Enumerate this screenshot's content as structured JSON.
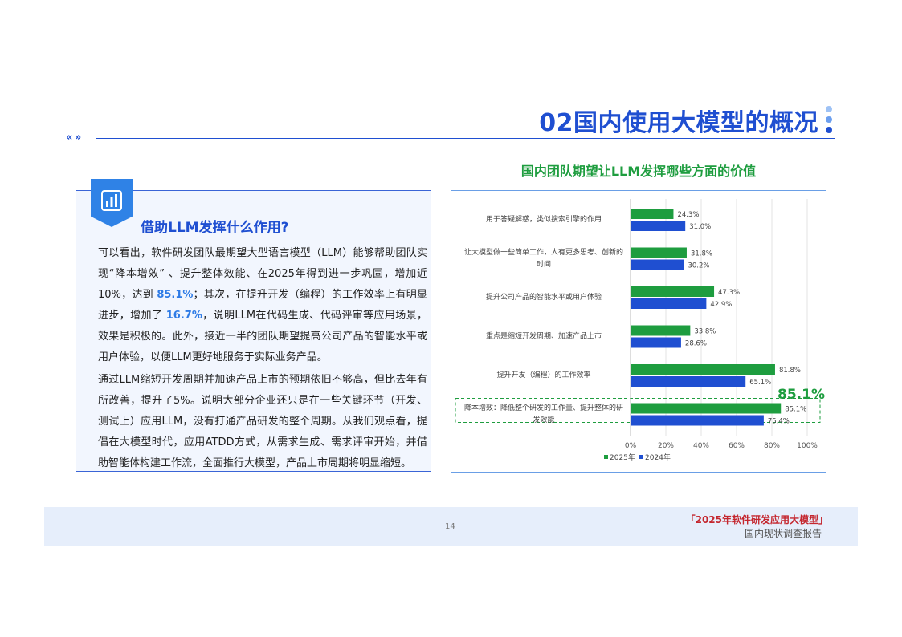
{
  "header": {
    "title": "02国内使用大模型的概况",
    "nav_chevrons": "« »"
  },
  "text_card": {
    "heading": "借助LLM发挥什么作用?",
    "para1": [
      "可以看出，软件研发团队最期望大型语言模型（LLM）能够帮助团队实现“降本增效” 、提升整体效能、在2025年得到进一步巩固，增加近10%，达到 ",
      "85.1%",
      "；其次，在提升开发（编程）的工作效率上有明显进步，增加了 ",
      "16.7%",
      "，说明LLM在代码生成、代码评审等应用场景，效果是积极的。此外，接近一半的团队期望提高公司产品的智能水平或用户体验，以便LLM更好地服务于实际业务产品。"
    ],
    "para2": "通过LLM缩短开发周期并加速产品上市的预期依旧不够高，但比去年有所改善，提升了5%。说明大部分企业还只是在一些关键环节（开发、测试上）应用LLM，没有打通产品研发的整个周期。从我们观点看，提倡在大模型时代，应用ATDD方式，从需求生成、需求评审开始，并借助智能体构建工作流，全面推行大模型，产品上市周期将明显缩短。"
  },
  "chart_title": "国内团队期望让LLM发挥哪些方面的价值",
  "callout": "85.1%",
  "chart_data": {
    "type": "bar",
    "orientation": "horizontal",
    "title": "国内团队期望让LLM发挥哪些方面的价值",
    "categories": [
      [
        "用于答疑解惑，类似搜索引擎的作用"
      ],
      [
        "让大模型做一些简单工作，人有更多思考、创新的",
        "时间"
      ],
      [
        "提升公司产品的智能水平或用户体验"
      ],
      [
        "重点是缩短开发周期、加速产品上市"
      ],
      [
        "提升开发（编程）的工作效率"
      ],
      [
        "降本增效：降低整个研发的工作量、提升整体的研",
        "发效能"
      ]
    ],
    "series": [
      {
        "name": "2025年",
        "color": "#1e9d3f",
        "values": [
          24.3,
          31.8,
          47.3,
          33.8,
          81.8,
          85.1
        ],
        "labels": [
          "24.3%",
          "31.8%",
          "47.3%",
          "33.8%",
          "81.8%",
          "85.1%"
        ]
      },
      {
        "name": "2024年",
        "color": "#1f4fd1",
        "values": [
          31.0,
          30.2,
          42.9,
          28.6,
          65.1,
          75.4
        ],
        "labels": [
          "31.0%",
          "30.2%",
          "42.9%",
          "28.6%",
          "65.1%",
          "75.4%"
        ]
      }
    ],
    "xlim": [
      0,
      100
    ],
    "xticks": [
      "0%",
      "20%",
      "40%",
      "60%",
      "80%",
      "100%"
    ],
    "grid": true,
    "legend": "bottom",
    "highlight_category": 5
  },
  "footer": {
    "page_number": "14",
    "report_title": "「2025年软件研发应用大模型」",
    "report_subtitle": "国内现状调查报告"
  }
}
